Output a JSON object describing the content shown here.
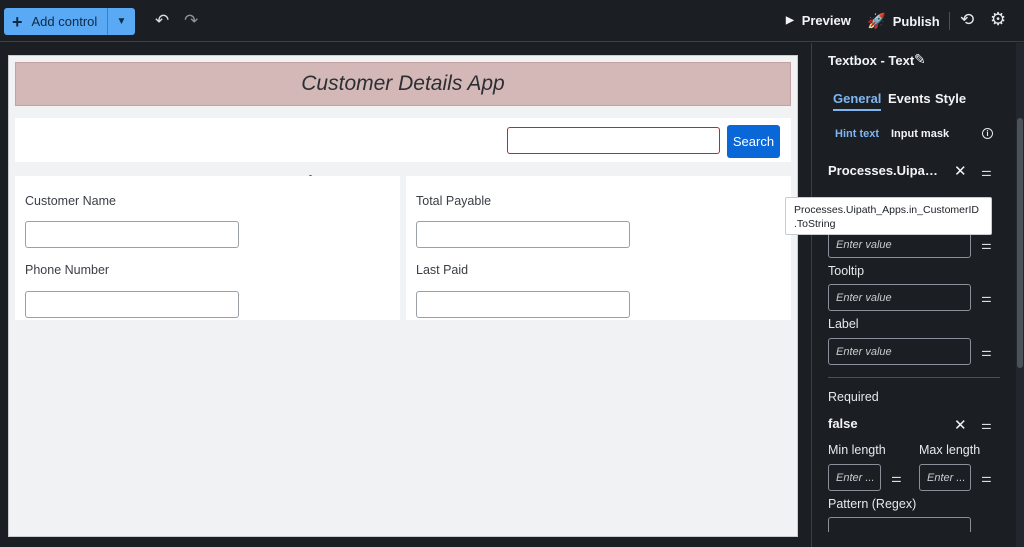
{
  "toolbar": {
    "add_control_label": "Add control",
    "preview_label": "Preview",
    "publish_label": "Publish"
  },
  "app": {
    "title": "Customer Details App",
    "search_button": "Search",
    "search_value": "",
    "fields": {
      "customer_name": "Customer Name",
      "total_payable": "Total Payable",
      "phone_number": "Phone Number",
      "last_paid": "Last Paid"
    }
  },
  "properties": {
    "title": "Textbox - Text",
    "tabs": [
      "General",
      "Events",
      "Style"
    ],
    "active_tab": "General",
    "subtabs": [
      "Hint text",
      "Input mask"
    ],
    "bound_value": "Processes.Uipath_...",
    "tooltip_text_line1": "Processes.Uipath_Apps.in_CustomerID",
    "tooltip_text_line2": ".ToString",
    "placeholder": "Enter value",
    "placeholder_short": "Enter ...",
    "tooltip_label": "Tooltip",
    "label_label": "Label",
    "required_label": "Required",
    "required_value": "false",
    "min_length_label": "Min length",
    "max_length_label": "Max length",
    "pattern_label": "Pattern (Regex)"
  },
  "colors": {
    "accent": "#0a67d8",
    "header_band": "#d4b8b8",
    "error_border": "#d02020",
    "active_tab": "#7fb6f2"
  }
}
